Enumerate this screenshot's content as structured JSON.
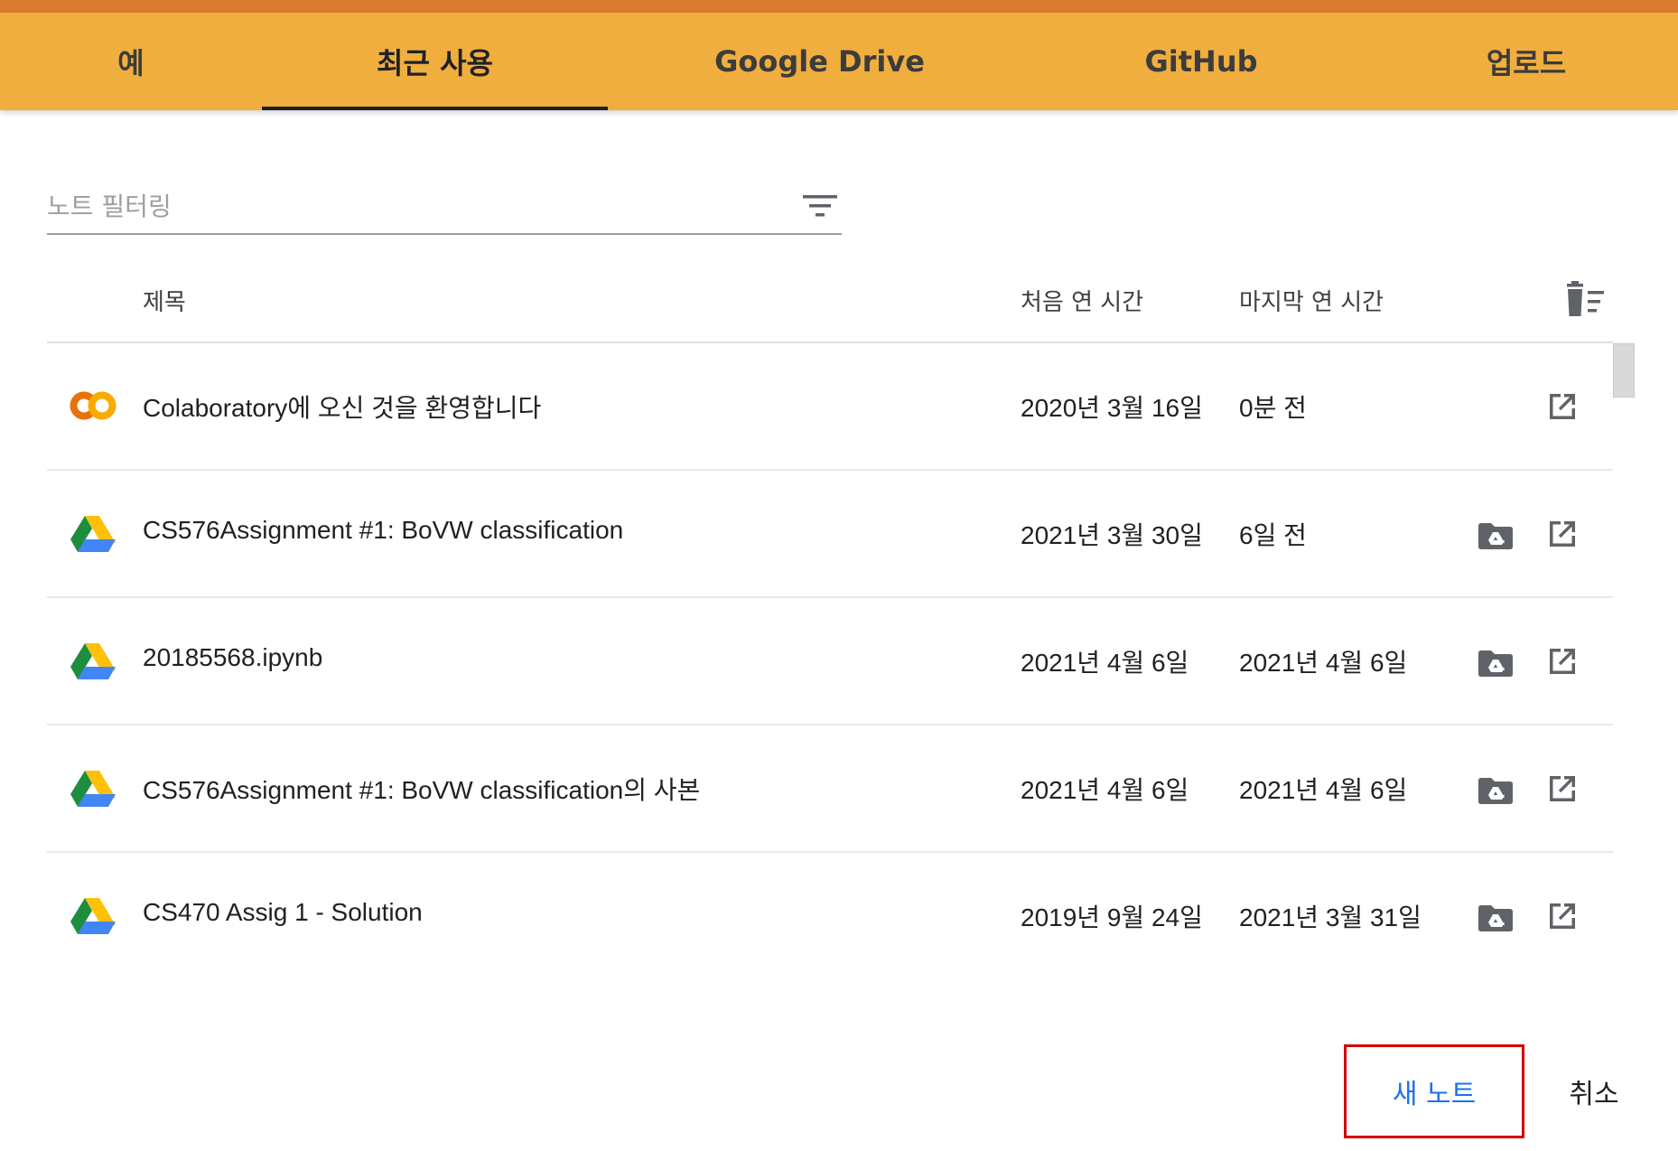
{
  "tabs": [
    {
      "label": "예",
      "active": false
    },
    {
      "label": "최근 사용",
      "active": true
    },
    {
      "label": "Google Drive",
      "active": false
    },
    {
      "label": "GitHub",
      "active": false
    },
    {
      "label": "업로드",
      "active": false
    }
  ],
  "filter": {
    "placeholder": "노트 필터링",
    "value": "",
    "icon": "filter-icon"
  },
  "table": {
    "headers": {
      "title": "제목",
      "first_opened": "처음 연 시간",
      "last_opened": "마지막 연 시간",
      "clear_icon": "trash-icon"
    },
    "rows": [
      {
        "icon": "colab-icon",
        "title": "Colaboratory에 오신 것을 환영합니다",
        "first_opened": "2020년 3월 16일",
        "last_opened": "0분 전",
        "has_drive_folder": false
      },
      {
        "icon": "google-drive-icon",
        "title": "CS576Assignment #1: BoVW classification",
        "first_opened": "2021년 3월 30일",
        "last_opened": "6일 전",
        "has_drive_folder": true
      },
      {
        "icon": "google-drive-icon",
        "title": "20185568.ipynb",
        "first_opened": "2021년 4월 6일",
        "last_opened": "2021년 4월 6일",
        "has_drive_folder": true
      },
      {
        "icon": "google-drive-icon",
        "title": "CS576Assignment #1: BoVW classification의 사본",
        "first_opened": "2021년 4월 6일",
        "last_opened": "2021년 4월 6일",
        "has_drive_folder": true
      },
      {
        "icon": "google-drive-icon",
        "title": "CS470 Assig 1 - Solution",
        "first_opened": "2019년 9월 24일",
        "last_opened": "2021년 3월 31일",
        "has_drive_folder": true
      }
    ]
  },
  "footer": {
    "new_notebook_label": "새 노트",
    "cancel_label": "취소"
  },
  "colors": {
    "tab_bar": "#f0ae3f",
    "top_strip": "#dd7a31",
    "primary_button_text": "#1a73e8",
    "highlight_border": "#d30000"
  }
}
